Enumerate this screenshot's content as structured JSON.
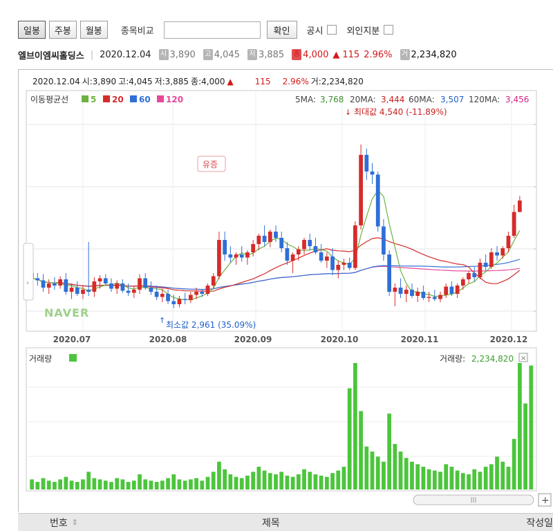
{
  "toolbar": {
    "tabs": [
      "일봉",
      "주봉",
      "월봉"
    ],
    "compare_label": "종목비교",
    "confirm_label": "확인",
    "disclosure_label": "공시",
    "foreign_label": "외인지분"
  },
  "stock": {
    "name": "엘브이엠씨홀딩스",
    "date": "2020.12.04",
    "open_badge": "시",
    "open": "3,890",
    "high_badge": "고",
    "high": "4,045",
    "low_badge": "저",
    "low": "3,885",
    "close_badge": "종",
    "close": "4,000",
    "change_arrow": "▲",
    "change": "115",
    "change_pct": "2.96%",
    "volume_badge": "거",
    "volume": "2,234,820"
  },
  "chart_header": {
    "date": "2020.12.04",
    "open": "시:3,890",
    "high": "고:4,045",
    "low": "저:3,885",
    "close": "종:4,000",
    "arrow": "▲",
    "change": "115",
    "pct": "2.96%",
    "volume": "거:2,234,820"
  },
  "legend": {
    "title": "이동평균선",
    "items": [
      {
        "label": "5",
        "color": "#6cb33f"
      },
      {
        "label": "20",
        "color": "#d62b2b"
      },
      {
        "label": "60",
        "color": "#2f6fd6"
      },
      {
        "label": "120",
        "color": "#e8489a"
      }
    ]
  },
  "ma_values": [
    {
      "label": "5MA:",
      "value": "3,768",
      "color": "#3f8f2f"
    },
    {
      "label": "20MA:",
      "value": "3,444",
      "color": "#c81e1e"
    },
    {
      "label": "60MA:",
      "value": "3,507",
      "color": "#2060c8"
    },
    {
      "label": "120MA:",
      "value": "3,456",
      "color": "#d81e8a"
    }
  ],
  "annotations": {
    "max_label": "최대값 4,540 (-11.89%)",
    "min_label": "최소값 2,961 (35.09%)",
    "event_label": "유증",
    "watermark": "NAVER"
  },
  "volume_panel": {
    "title": "거래량",
    "value_label": "거래량:",
    "value": "2,234,820",
    "close_icon": "×"
  },
  "table_head": {
    "col1": "번호",
    "col1_sort": "⇕",
    "col2": "제목",
    "col3": "작성일"
  },
  "colors": {
    "up": "#d62b2b",
    "down": "#2f6fd6",
    "volume": "#4cc53c"
  },
  "chart_data": {
    "type": "candlestick",
    "x_ticks": [
      "2020.07",
      "2020.08",
      "2020.09",
      "2020.10",
      "2020.11",
      "2020.12"
    ],
    "price_range": [
      2800,
      4800
    ],
    "candles": [
      {
        "o": 3300,
        "h": 3380,
        "l": 3150,
        "c": 3250
      },
      {
        "o": 3250,
        "h": 3300,
        "l": 3180,
        "c": 3230
      },
      {
        "o": 3230,
        "h": 3290,
        "l": 3120,
        "c": 3160
      },
      {
        "o": 3160,
        "h": 3240,
        "l": 3100,
        "c": 3200
      },
      {
        "o": 3200,
        "h": 3260,
        "l": 3140,
        "c": 3180
      },
      {
        "o": 3180,
        "h": 3270,
        "l": 3150,
        "c": 3240
      },
      {
        "o": 3240,
        "h": 3300,
        "l": 3090,
        "c": 3120
      },
      {
        "o": 3120,
        "h": 3200,
        "l": 3050,
        "c": 3160
      },
      {
        "o": 3160,
        "h": 3220,
        "l": 3080,
        "c": 3100
      },
      {
        "o": 3100,
        "h": 3180,
        "l": 3050,
        "c": 3140
      },
      {
        "o": 3140,
        "h": 3600,
        "l": 3080,
        "c": 3120
      },
      {
        "o": 3120,
        "h": 3260,
        "l": 3070,
        "c": 3220
      },
      {
        "o": 3220,
        "h": 3280,
        "l": 3150,
        "c": 3250
      },
      {
        "o": 3250,
        "h": 3290,
        "l": 3180,
        "c": 3200
      },
      {
        "o": 3200,
        "h": 3250,
        "l": 3120,
        "c": 3150
      },
      {
        "o": 3150,
        "h": 3230,
        "l": 3100,
        "c": 3200
      },
      {
        "o": 3200,
        "h": 3240,
        "l": 3110,
        "c": 3130
      },
      {
        "o": 3130,
        "h": 3200,
        "l": 3080,
        "c": 3110
      },
      {
        "o": 3110,
        "h": 3170,
        "l": 3060,
        "c": 3140
      },
      {
        "o": 3140,
        "h": 3290,
        "l": 3100,
        "c": 3250
      },
      {
        "o": 3250,
        "h": 3300,
        "l": 3140,
        "c": 3160
      },
      {
        "o": 3160,
        "h": 3220,
        "l": 3090,
        "c": 3120
      },
      {
        "o": 3120,
        "h": 3180,
        "l": 3040,
        "c": 3070
      },
      {
        "o": 3070,
        "h": 3150,
        "l": 3020,
        "c": 3100
      },
      {
        "o": 3100,
        "h": 3140,
        "l": 3000,
        "c": 3030
      },
      {
        "o": 3030,
        "h": 3090,
        "l": 2961,
        "c": 3000
      },
      {
        "o": 3000,
        "h": 3080,
        "l": 2970,
        "c": 3050
      },
      {
        "o": 3050,
        "h": 3110,
        "l": 3000,
        "c": 3040
      },
      {
        "o": 3040,
        "h": 3120,
        "l": 3010,
        "c": 3090
      },
      {
        "o": 3090,
        "h": 3160,
        "l": 3050,
        "c": 3120
      },
      {
        "o": 3120,
        "h": 3140,
        "l": 3070,
        "c": 3100
      },
      {
        "o": 3100,
        "h": 3200,
        "l": 3080,
        "c": 3180
      },
      {
        "o": 3180,
        "h": 3300,
        "l": 3150,
        "c": 3270
      },
      {
        "o": 3270,
        "h": 3700,
        "l": 3240,
        "c": 3620
      },
      {
        "o": 3620,
        "h": 3700,
        "l": 3420,
        "c": 3480
      },
      {
        "o": 3480,
        "h": 3560,
        "l": 3400,
        "c": 3450
      },
      {
        "o": 3450,
        "h": 3500,
        "l": 3380,
        "c": 3480
      },
      {
        "o": 3480,
        "h": 3560,
        "l": 3410,
        "c": 3450
      },
      {
        "o": 3450,
        "h": 3520,
        "l": 3380,
        "c": 3500
      },
      {
        "o": 3500,
        "h": 3620,
        "l": 3460,
        "c": 3580
      },
      {
        "o": 3580,
        "h": 3680,
        "l": 3520,
        "c": 3660
      },
      {
        "o": 3660,
        "h": 3760,
        "l": 3560,
        "c": 3600
      },
      {
        "o": 3600,
        "h": 3720,
        "l": 3550,
        "c": 3700
      },
      {
        "o": 3700,
        "h": 3760,
        "l": 3600,
        "c": 3640
      },
      {
        "o": 3640,
        "h": 3700,
        "l": 3500,
        "c": 3540
      },
      {
        "o": 3540,
        "h": 3600,
        "l": 3380,
        "c": 3420
      },
      {
        "o": 3420,
        "h": 3500,
        "l": 3300,
        "c": 3480
      },
      {
        "o": 3480,
        "h": 3560,
        "l": 3420,
        "c": 3530
      },
      {
        "o": 3530,
        "h": 3640,
        "l": 3480,
        "c": 3620
      },
      {
        "o": 3620,
        "h": 3680,
        "l": 3520,
        "c": 3560
      },
      {
        "o": 3560,
        "h": 3640,
        "l": 3480,
        "c": 3500
      },
      {
        "o": 3500,
        "h": 3580,
        "l": 3400,
        "c": 3420
      },
      {
        "o": 3420,
        "h": 3500,
        "l": 3350,
        "c": 3460
      },
      {
        "o": 3460,
        "h": 3540,
        "l": 3280,
        "c": 3330
      },
      {
        "o": 3330,
        "h": 3420,
        "l": 3250,
        "c": 3380
      },
      {
        "o": 3380,
        "h": 3440,
        "l": 3330,
        "c": 3400
      },
      {
        "o": 3400,
        "h": 3450,
        "l": 3330,
        "c": 3350
      },
      {
        "o": 3350,
        "h": 3800,
        "l": 3330,
        "c": 3760
      },
      {
        "o": 3760,
        "h": 4540,
        "l": 3720,
        "c": 4440
      },
      {
        "o": 4440,
        "h": 4500,
        "l": 4200,
        "c": 4280
      },
      {
        "o": 4280,
        "h": 4360,
        "l": 4160,
        "c": 4250
      },
      {
        "o": 4250,
        "h": 4280,
        "l": 3700,
        "c": 3750
      },
      {
        "o": 3750,
        "h": 3820,
        "l": 3420,
        "c": 3480
      },
      {
        "o": 3480,
        "h": 3520,
        "l": 3080,
        "c": 3120
      },
      {
        "o": 3120,
        "h": 3200,
        "l": 2980,
        "c": 3160
      },
      {
        "o": 3160,
        "h": 3250,
        "l": 3060,
        "c": 3100
      },
      {
        "o": 3100,
        "h": 3180,
        "l": 3020,
        "c": 3140
      },
      {
        "o": 3140,
        "h": 3200,
        "l": 3060,
        "c": 3080
      },
      {
        "o": 3080,
        "h": 3160,
        "l": 3020,
        "c": 3120
      },
      {
        "o": 3120,
        "h": 3180,
        "l": 3040,
        "c": 3060
      },
      {
        "o": 3060,
        "h": 3120,
        "l": 3020,
        "c": 3070
      },
      {
        "o": 3070,
        "h": 3140,
        "l": 3030,
        "c": 3050
      },
      {
        "o": 3050,
        "h": 3120,
        "l": 3020,
        "c": 3090
      },
      {
        "o": 3090,
        "h": 3200,
        "l": 3060,
        "c": 3170
      },
      {
        "o": 3170,
        "h": 3220,
        "l": 3080,
        "c": 3100
      },
      {
        "o": 3100,
        "h": 3200,
        "l": 3060,
        "c": 3180
      },
      {
        "o": 3180,
        "h": 3260,
        "l": 3140,
        "c": 3240
      },
      {
        "o": 3240,
        "h": 3320,
        "l": 3200,
        "c": 3300
      },
      {
        "o": 3300,
        "h": 3360,
        "l": 3220,
        "c": 3260
      },
      {
        "o": 3260,
        "h": 3440,
        "l": 3240,
        "c": 3400
      },
      {
        "o": 3400,
        "h": 3480,
        "l": 3320,
        "c": 3360
      },
      {
        "o": 3360,
        "h": 3540,
        "l": 3340,
        "c": 3500
      },
      {
        "o": 3500,
        "h": 3560,
        "l": 3420,
        "c": 3470
      },
      {
        "o": 3470,
        "h": 3560,
        "l": 3440,
        "c": 3540
      },
      {
        "o": 3540,
        "h": 3700,
        "l": 3500,
        "c": 3660
      },
      {
        "o": 3660,
        "h": 3960,
        "l": 3640,
        "c": 3890
      },
      {
        "o": 3890,
        "h": 4045,
        "l": 3885,
        "c": 4000
      }
    ],
    "volumes": [
      8,
      6,
      9,
      7,
      6,
      8,
      10,
      7,
      6,
      8,
      14,
      9,
      8,
      7,
      6,
      9,
      8,
      6,
      7,
      12,
      8,
      7,
      6,
      7,
      9,
      12,
      8,
      7,
      8,
      9,
      7,
      10,
      14,
      22,
      16,
      12,
      10,
      9,
      11,
      14,
      18,
      15,
      13,
      12,
      14,
      11,
      10,
      12,
      16,
      14,
      12,
      11,
      10,
      13,
      15,
      18,
      80,
      100,
      62,
      34,
      30,
      26,
      22,
      60,
      36,
      30,
      25,
      22,
      20,
      18,
      16,
      15,
      14,
      20,
      18,
      15,
      13,
      12,
      16,
      14,
      18,
      20,
      26,
      22,
      18,
      40,
      100,
      68,
      98
    ]
  }
}
